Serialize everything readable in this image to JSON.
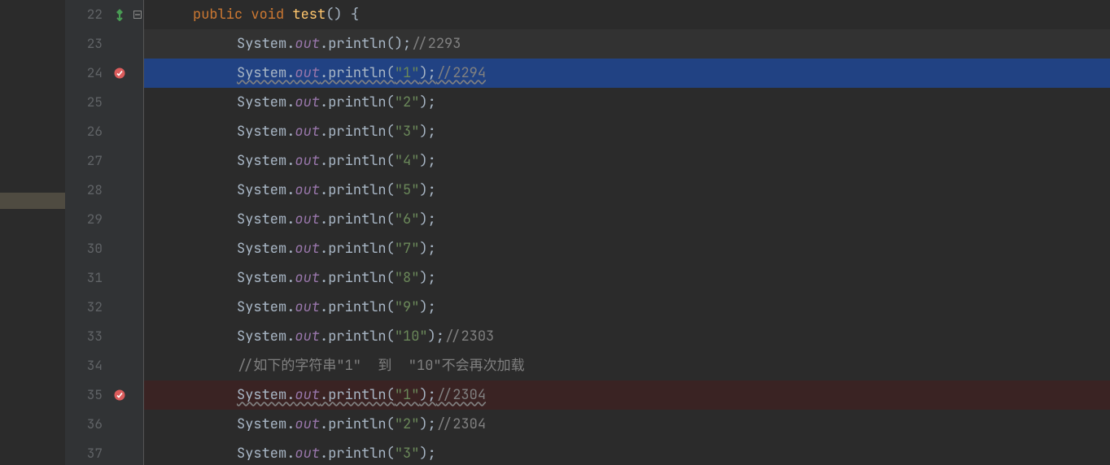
{
  "lines": [
    {
      "num": "22",
      "icon": "vcs",
      "fold": true,
      "row": "",
      "indent": 1,
      "segs": [
        {
          "t": "public ",
          "c": "tk-kw"
        },
        {
          "t": "void ",
          "c": "tk-kw"
        },
        {
          "t": "test",
          "c": "tk-method"
        },
        {
          "t": "() {",
          "c": "tk-punc"
        }
      ]
    },
    {
      "num": "23",
      "icon": "",
      "fold": false,
      "row": "dim",
      "indent": 2,
      "segs": [
        {
          "t": "System.",
          "c": "tk-ident"
        },
        {
          "t": "out",
          "c": "tk-field"
        },
        {
          "t": ".println();",
          "c": "tk-ident"
        },
        {
          "t": "//2293",
          "c": "tk-cmt"
        }
      ]
    },
    {
      "num": "24",
      "icon": "bp",
      "fold": false,
      "row": "sel",
      "indent": 2,
      "wavy": true,
      "segs": [
        {
          "t": "System.",
          "c": "tk-ident"
        },
        {
          "t": "out",
          "c": "tk-field"
        },
        {
          "t": ".println(",
          "c": "tk-ident"
        },
        {
          "t": "\"1\"",
          "c": "tk-str"
        },
        {
          "t": ");",
          "c": "tk-ident"
        },
        {
          "t": "//2294",
          "c": "tk-cmt"
        }
      ]
    },
    {
      "num": "25",
      "icon": "",
      "fold": false,
      "row": "",
      "indent": 2,
      "segs": [
        {
          "t": "System.",
          "c": "tk-ident"
        },
        {
          "t": "out",
          "c": "tk-field"
        },
        {
          "t": ".println(",
          "c": "tk-ident"
        },
        {
          "t": "\"2\"",
          "c": "tk-str"
        },
        {
          "t": ");",
          "c": "tk-ident"
        }
      ]
    },
    {
      "num": "26",
      "icon": "",
      "fold": false,
      "row": "",
      "indent": 2,
      "segs": [
        {
          "t": "System.",
          "c": "tk-ident"
        },
        {
          "t": "out",
          "c": "tk-field"
        },
        {
          "t": ".println(",
          "c": "tk-ident"
        },
        {
          "t": "\"3\"",
          "c": "tk-str"
        },
        {
          "t": ");",
          "c": "tk-ident"
        }
      ]
    },
    {
      "num": "27",
      "icon": "",
      "fold": false,
      "row": "",
      "indent": 2,
      "segs": [
        {
          "t": "System.",
          "c": "tk-ident"
        },
        {
          "t": "out",
          "c": "tk-field"
        },
        {
          "t": ".println(",
          "c": "tk-ident"
        },
        {
          "t": "\"4\"",
          "c": "tk-str"
        },
        {
          "t": ");",
          "c": "tk-ident"
        }
      ]
    },
    {
      "num": "28",
      "icon": "",
      "fold": false,
      "row": "",
      "indent": 2,
      "segs": [
        {
          "t": "System.",
          "c": "tk-ident"
        },
        {
          "t": "out",
          "c": "tk-field"
        },
        {
          "t": ".println(",
          "c": "tk-ident"
        },
        {
          "t": "\"5\"",
          "c": "tk-str"
        },
        {
          "t": ");",
          "c": "tk-ident"
        }
      ]
    },
    {
      "num": "29",
      "icon": "",
      "fold": false,
      "row": "",
      "indent": 2,
      "segs": [
        {
          "t": "System.",
          "c": "tk-ident"
        },
        {
          "t": "out",
          "c": "tk-field"
        },
        {
          "t": ".println(",
          "c": "tk-ident"
        },
        {
          "t": "\"6\"",
          "c": "tk-str"
        },
        {
          "t": ");",
          "c": "tk-ident"
        }
      ]
    },
    {
      "num": "30",
      "icon": "",
      "fold": false,
      "row": "",
      "indent": 2,
      "segs": [
        {
          "t": "System.",
          "c": "tk-ident"
        },
        {
          "t": "out",
          "c": "tk-field"
        },
        {
          "t": ".println(",
          "c": "tk-ident"
        },
        {
          "t": "\"7\"",
          "c": "tk-str"
        },
        {
          "t": ");",
          "c": "tk-ident"
        }
      ]
    },
    {
      "num": "31",
      "icon": "",
      "fold": false,
      "row": "",
      "indent": 2,
      "segs": [
        {
          "t": "System.",
          "c": "tk-ident"
        },
        {
          "t": "out",
          "c": "tk-field"
        },
        {
          "t": ".println(",
          "c": "tk-ident"
        },
        {
          "t": "\"8\"",
          "c": "tk-str"
        },
        {
          "t": ");",
          "c": "tk-ident"
        }
      ]
    },
    {
      "num": "32",
      "icon": "",
      "fold": false,
      "row": "",
      "indent": 2,
      "segs": [
        {
          "t": "System.",
          "c": "tk-ident"
        },
        {
          "t": "out",
          "c": "tk-field"
        },
        {
          "t": ".println(",
          "c": "tk-ident"
        },
        {
          "t": "\"9\"",
          "c": "tk-str"
        },
        {
          "t": ");",
          "c": "tk-ident"
        }
      ]
    },
    {
      "num": "33",
      "icon": "",
      "fold": false,
      "row": "",
      "indent": 2,
      "segs": [
        {
          "t": "System.",
          "c": "tk-ident"
        },
        {
          "t": "out",
          "c": "tk-field"
        },
        {
          "t": ".println(",
          "c": "tk-ident"
        },
        {
          "t": "\"10\"",
          "c": "tk-str"
        },
        {
          "t": ");",
          "c": "tk-ident"
        },
        {
          "t": "//2303",
          "c": "tk-cmt"
        }
      ]
    },
    {
      "num": "34",
      "icon": "",
      "fold": false,
      "row": "",
      "indent": 2,
      "segs": [
        {
          "t": "//如下的字符串\"1\"  到  \"10\"不会再次加载",
          "c": "tk-cmt"
        }
      ]
    },
    {
      "num": "35",
      "icon": "bp",
      "fold": false,
      "row": "bpt",
      "indent": 2,
      "wavy": true,
      "segs": [
        {
          "t": "System.",
          "c": "tk-ident"
        },
        {
          "t": "out",
          "c": "tk-field"
        },
        {
          "t": ".println(",
          "c": "tk-ident"
        },
        {
          "t": "\"1\"",
          "c": "tk-str"
        },
        {
          "t": ");",
          "c": "tk-ident"
        },
        {
          "t": "//2304",
          "c": "tk-cmt"
        }
      ]
    },
    {
      "num": "36",
      "icon": "",
      "fold": false,
      "row": "",
      "indent": 2,
      "segs": [
        {
          "t": "System.",
          "c": "tk-ident"
        },
        {
          "t": "out",
          "c": "tk-field"
        },
        {
          "t": ".println(",
          "c": "tk-ident"
        },
        {
          "t": "\"2\"",
          "c": "tk-str"
        },
        {
          "t": ");",
          "c": "tk-ident"
        },
        {
          "t": "//2304",
          "c": "tk-cmt"
        }
      ]
    },
    {
      "num": "37",
      "icon": "",
      "fold": false,
      "row": "",
      "indent": 2,
      "segs": [
        {
          "t": "System.",
          "c": "tk-ident"
        },
        {
          "t": "out",
          "c": "tk-field"
        },
        {
          "t": ".println(",
          "c": "tk-ident"
        },
        {
          "t": "\"3\"",
          "c": "tk-str"
        },
        {
          "t": ");",
          "c": "tk-ident"
        }
      ]
    }
  ],
  "icons": {
    "vcs": "vcs-change-icon",
    "bp": "breakpoint-icon"
  }
}
